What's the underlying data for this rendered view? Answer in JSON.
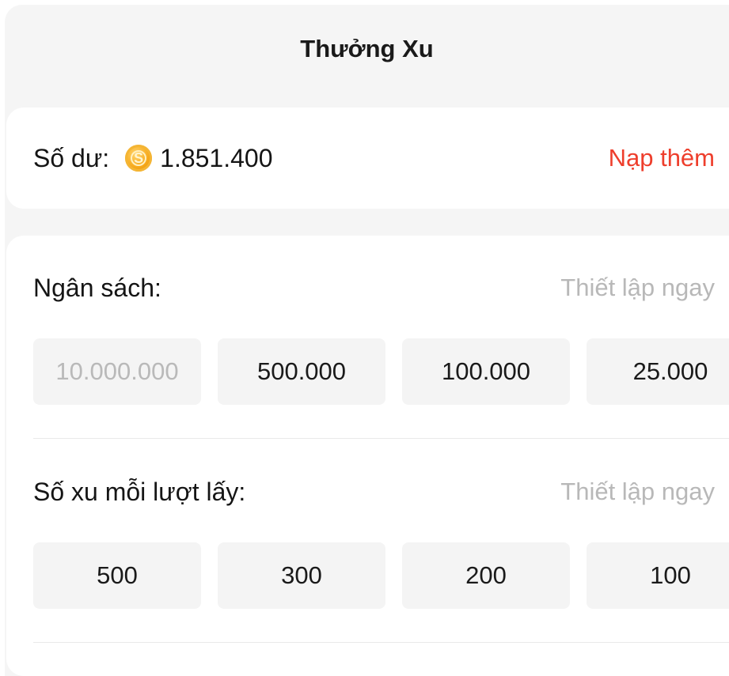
{
  "header": {
    "title": "Thưởng Xu"
  },
  "balance": {
    "label": "Số dư:",
    "coin_icon": "coin-icon",
    "coin_symbol": "S",
    "amount": "1.851.400",
    "topup_label": "Nạp thêm",
    "accent_color": "#ee3e2c"
  },
  "budget": {
    "title": "Ngân sách:",
    "setup_label": "Thiết lập ngay",
    "options": [
      "10.000.000",
      "500.000",
      "100.000",
      "25.000"
    ],
    "disabled_option": "10.000.000"
  },
  "per_claim": {
    "title": "Số xu mỗi lượt lấy:",
    "setup_label": "Thiết lập ngay",
    "options": [
      "500",
      "300",
      "200",
      "100"
    ]
  }
}
